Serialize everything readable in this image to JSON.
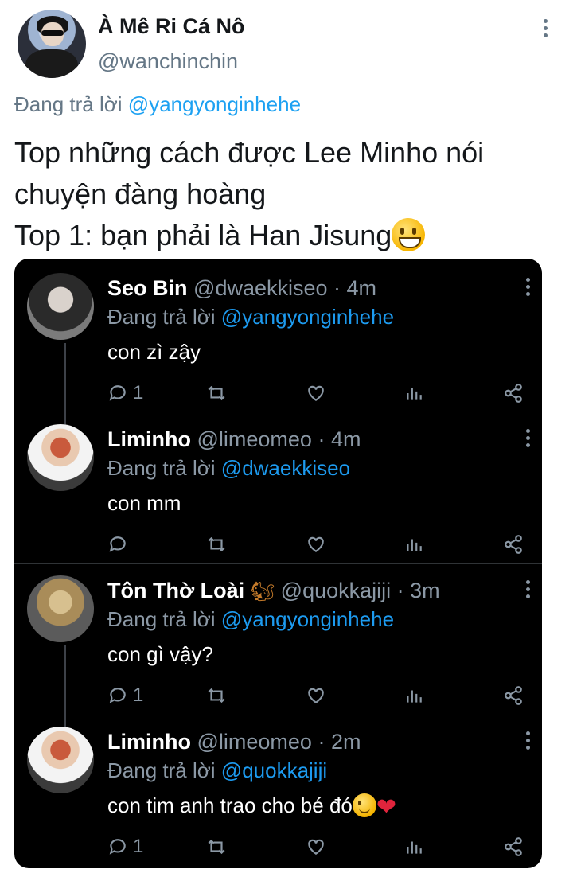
{
  "tweet": {
    "display_name": "À Mê Ri Cá Nô",
    "handle": "@wanchinchin",
    "reply_prefix": "Đang trả lời",
    "reply_to": "@yangyonginhehe",
    "text_line1": "Top những cách được Lee Minho nói",
    "text_line2": "chuyện đàng hoàng",
    "text_line3": "Top 1: bạn phải là Han Jisung",
    "more_icon": "more-vertical-icon"
  },
  "screenshot": {
    "replies": [
      {
        "name": "Seo Bin",
        "handle": "@dwaekkiseo",
        "time": "· 4m",
        "reply_prefix": "Đang trả lời",
        "reply_to": "@yangyonginhehe",
        "text": "con zì zậy",
        "reply_count": "1"
      },
      {
        "name": "Liminho",
        "handle": "@limeomeo",
        "time": "· 4m",
        "reply_prefix": "Đang trả lời",
        "reply_to": "@dwaekkiseo",
        "text": "con mm",
        "reply_count": ""
      },
      {
        "name": "Tôn Thờ Loài",
        "handle": "@quokkajiji",
        "time": "· 3m",
        "reply_prefix": "Đang trả lời",
        "reply_to": "@yangyonginhehe",
        "text": "con gì vậy?",
        "reply_count": "1"
      },
      {
        "name": "Liminho",
        "handle": "@limeomeo",
        "time": "· 2m",
        "reply_prefix": "Đang trả lời",
        "reply_to": "@quokkajiji",
        "text": "con tim anh trao cho bé đó",
        "reply_count": "1"
      }
    ]
  },
  "colors": {
    "mention": "#1da1f2",
    "muted": "#657786",
    "dark_bg": "#000000"
  }
}
